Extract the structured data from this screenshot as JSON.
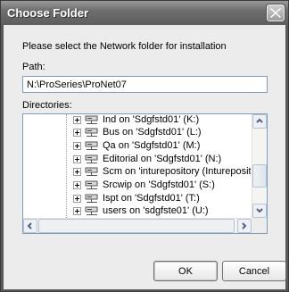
{
  "dialog": {
    "title": "Choose Folder",
    "prompt": "Please select the Network folder for installation",
    "path_label": "Path:",
    "path_value": "N:\\ProSeries\\ProNet07",
    "directories_label": "Directories:",
    "ok_label": "OK",
    "cancel_label": "Cancel"
  },
  "tree": {
    "items": [
      {
        "label": "Ind on 'Sdgfstd01' (K:)",
        "icon": "network-drive-icon"
      },
      {
        "label": "Bus on 'Sdgfstd01' (L:)",
        "icon": "network-drive-icon"
      },
      {
        "label": "Qa on 'Sdgfstd01' (M:)",
        "icon": "network-drive-icon"
      },
      {
        "label": "Editorial on 'Sdgfstd01' (N:)",
        "icon": "network-drive-icon"
      },
      {
        "label": "Scm on 'inturepository (Inturepository)' (",
        "icon": "network-drive-icon"
      },
      {
        "label": "Srcwip on 'Sdgfstd01' (S:)",
        "icon": "network-drive-icon"
      },
      {
        "label": "Ispt on 'Sdgfstd01' (T:)",
        "icon": "network-drive-icon"
      },
      {
        "label": "users on 'sdgfste01' (U:)",
        "icon": "network-drive-icon"
      }
    ]
  }
}
